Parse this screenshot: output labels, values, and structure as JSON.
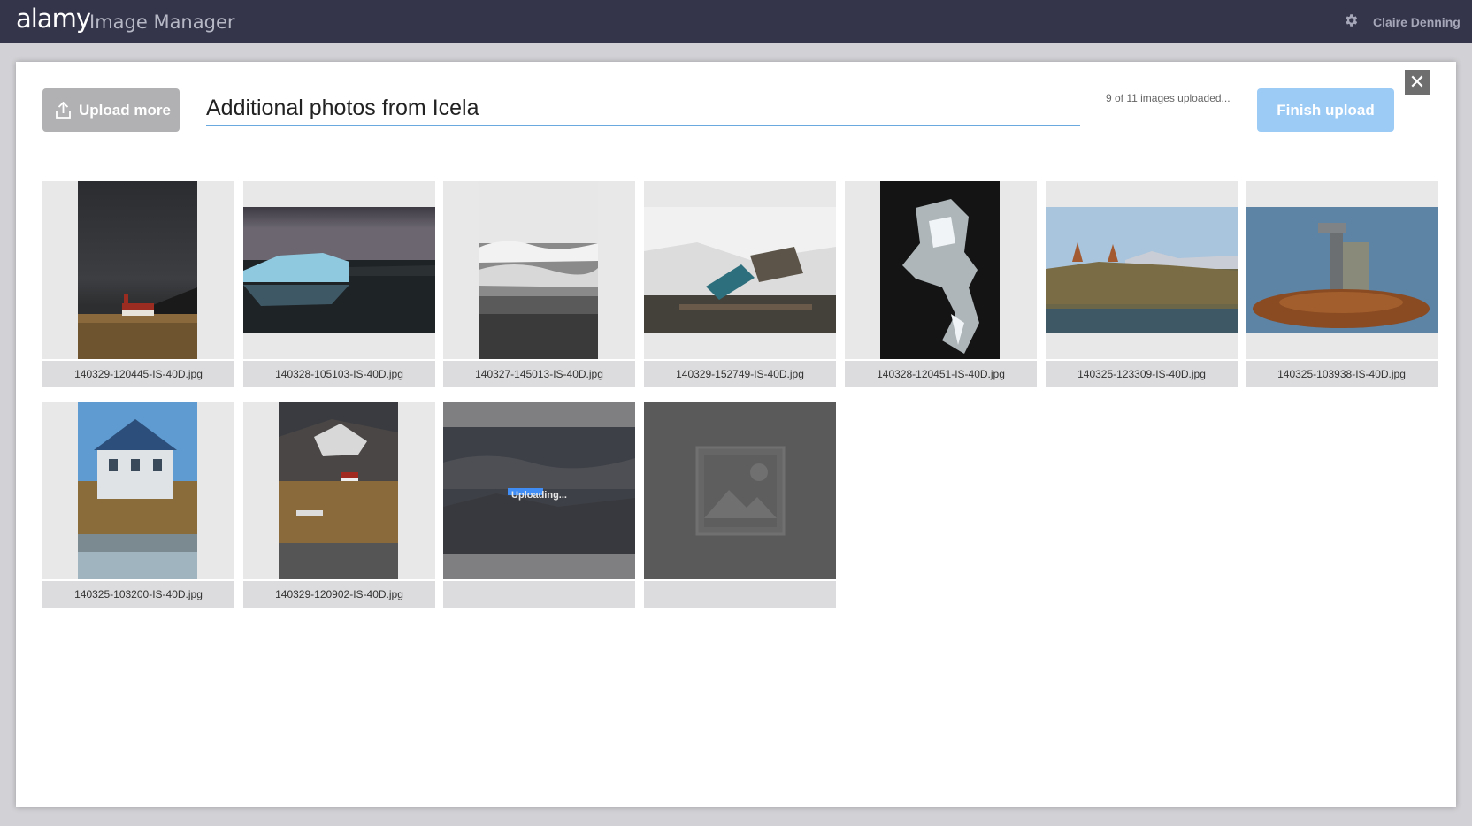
{
  "header": {
    "brand": "alamy",
    "product": "Image Manager",
    "settings_icon": "gear-icon",
    "user_name": "Claire Denning"
  },
  "toolbar": {
    "upload_more_label": "Upload more",
    "upload_icon": "upload-icon",
    "title_value": "Additional photos from Icela",
    "progress_text": "9 of 11 images uploaded...",
    "finish_label": "Finish upload",
    "close_icon": "close-icon"
  },
  "images": [
    {
      "filename": "140329-120445-IS-40D.jpg"
    },
    {
      "filename": "140328-105103-IS-40D.jpg"
    },
    {
      "filename": "140327-145013-IS-40D.jpg"
    },
    {
      "filename": "140329-152749-IS-40D.jpg"
    },
    {
      "filename": "140328-120451-IS-40D.jpg"
    },
    {
      "filename": "140325-123309-IS-40D.jpg"
    },
    {
      "filename": "140325-103938-IS-40D.jpg"
    },
    {
      "filename": "140325-103200-IS-40D.jpg"
    },
    {
      "filename": "140329-120902-IS-40D.jpg"
    },
    {
      "filename": "",
      "status": "Uploading..."
    },
    {
      "filename": "",
      "status": "placeholder"
    }
  ],
  "colors": {
    "topbar": "#34344a",
    "finish_button": "#9ccbf6",
    "upload_more_button": "#b1b1b3",
    "progress_bar": "#3f8df5"
  }
}
